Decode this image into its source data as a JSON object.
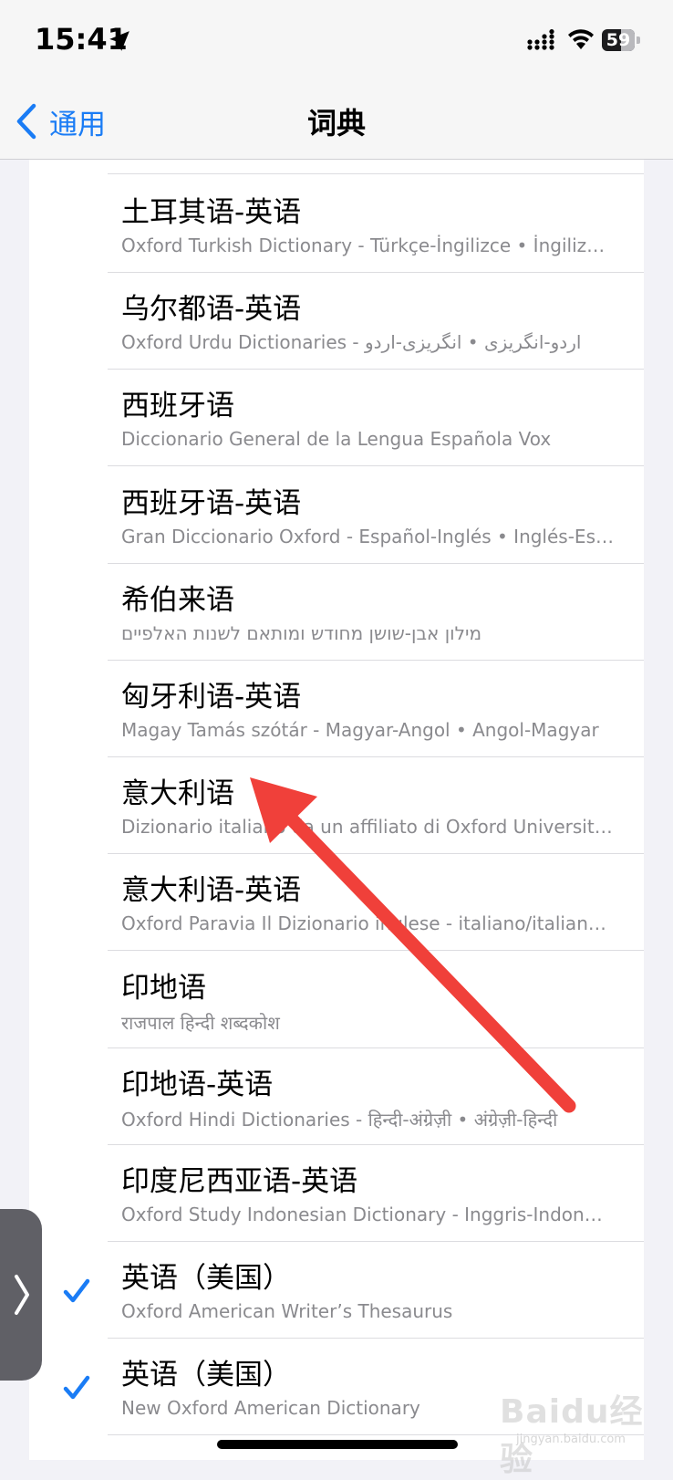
{
  "status_bar": {
    "time": "15:41",
    "battery": "59",
    "battery_level_pct": 59,
    "icons": [
      "location-arrow-icon",
      "cellular-signal-icon",
      "wifi-icon",
      "battery-icon"
    ]
  },
  "nav": {
    "back_label": "通用",
    "title": "词典"
  },
  "dictionaries": [
    {
      "title": "土耳其语-英语",
      "subtitle": "Oxford Turkish Dictionary - Türkçe-İngilizce • İngilizce-Türkçe",
      "checked": false
    },
    {
      "title": "乌尔都语-英语",
      "subtitle": "Oxford Urdu Dictionaries - اردو-انگریزی • انگریزی-اردو",
      "checked": false
    },
    {
      "title": "西班牙语",
      "subtitle": "Diccionario General de la Lengua Española Vox",
      "checked": false
    },
    {
      "title": "西班牙语-英语",
      "subtitle": "Gran Diccionario Oxford - Español-Inglés • Inglés-Español",
      "checked": false
    },
    {
      "title": "希伯来语",
      "subtitle": "מילון אבן-שושן מחודש ומותאם לשנות האלפיים",
      "checked": false
    },
    {
      "title": "匈牙利语-英语",
      "subtitle": "Magay Tamás szótár - Magyar-Angol • Angol-Magyar",
      "checked": false
    },
    {
      "title": "意大利语",
      "subtitle": "Dizionario italiano da un affiliato di Oxford University Press",
      "checked": false
    },
    {
      "title": "意大利语-英语",
      "subtitle": "Oxford Paravia Il Dizionario inglese - italiano/italiano - inglese",
      "checked": false
    },
    {
      "title": "印地语",
      "subtitle": "राजपाल हिन्दी शब्दकोश",
      "checked": false
    },
    {
      "title": "印地语-英语",
      "subtitle": "Oxford Hindi Dictionaries - हिन्दी-अंग्रेज़ी • अंग्रेज़ी-हिन्दी",
      "checked": false
    },
    {
      "title": "印度尼西亚语-英语",
      "subtitle": "Oxford Study Indonesian Dictionary - Inggris-Indonesia",
      "checked": false
    },
    {
      "title": "英语（美国）",
      "subtitle": "Oxford American Writer’s Thesaurus",
      "checked": true
    },
    {
      "title": "英语（美国）",
      "subtitle": "New Oxford American Dictionary",
      "checked": true
    }
  ],
  "colors": {
    "accent": "#1a7cf5",
    "annotation_arrow": "#f0403a"
  },
  "watermark": {
    "text": "Baidu经验",
    "sub": "jingyan.baidu.com"
  }
}
